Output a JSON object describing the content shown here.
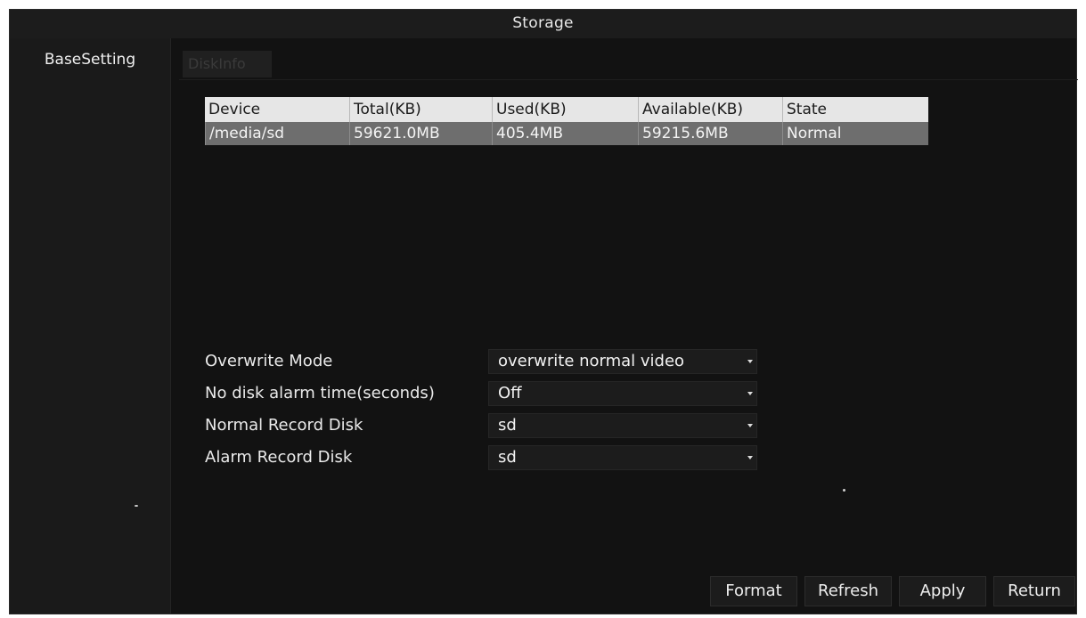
{
  "window": {
    "title": "Storage"
  },
  "sidebar": {
    "items": [
      {
        "label": "BaseSetting"
      }
    ]
  },
  "tabs": [
    {
      "label": "DiskInfo"
    }
  ],
  "disk_table": {
    "columns": [
      "Device",
      "Total(KB)",
      "Used(KB)",
      "Available(KB)",
      "State"
    ],
    "rows": [
      [
        "/media/sd",
        "59621.0MB",
        "405.4MB",
        "59215.6MB",
        "Normal"
      ]
    ]
  },
  "settings": [
    {
      "label": "Overwrite Mode",
      "value": "overwrite normal video"
    },
    {
      "label": "No disk alarm time(seconds)",
      "value": "Off"
    },
    {
      "label": "Normal Record Disk",
      "value": "sd"
    },
    {
      "label": "Alarm Record Disk",
      "value": "sd"
    }
  ],
  "buttons": {
    "format": "Format",
    "refresh": "Refresh",
    "apply": "Apply",
    "return": "Return"
  },
  "colors": {
    "background": "#121212",
    "table_header": "#e6e6e6",
    "table_selected_row": "#6e6e6e"
  }
}
